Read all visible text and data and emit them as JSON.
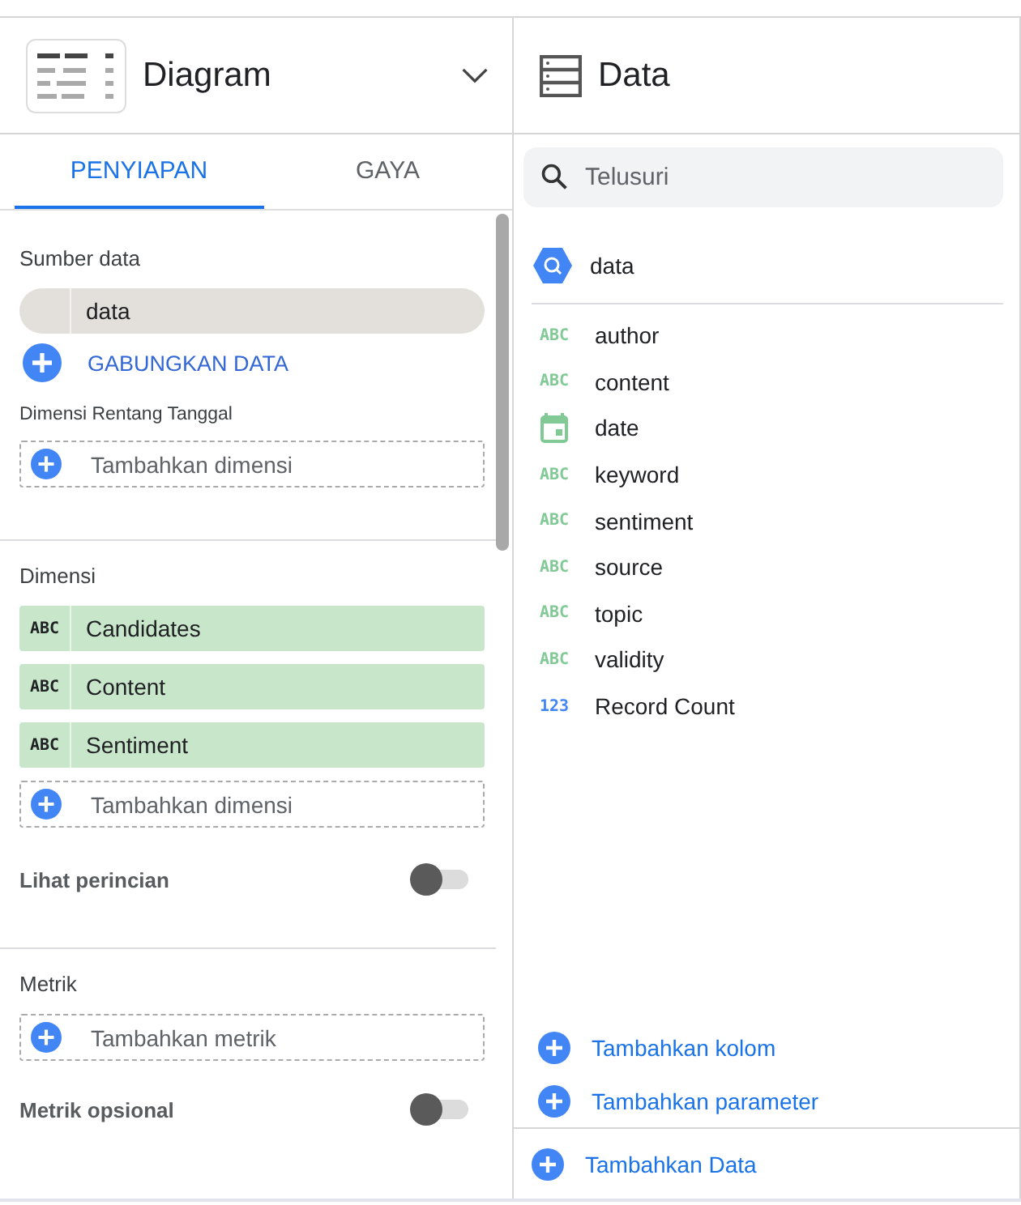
{
  "chart_panel": {
    "title": "Diagram"
  },
  "tabs": [
    {
      "label": "PENYIAPAN",
      "selected": true
    },
    {
      "label": "GAYA",
      "selected": false
    }
  ],
  "data_source": {
    "heading": "Sumber data",
    "name": "data",
    "blend_label": "GABUNGKAN DATA"
  },
  "date_range": {
    "heading": "Dimensi Rentang Tanggal",
    "add_label": "Tambahkan dimensi"
  },
  "dimensions": {
    "heading": "Dimensi",
    "items": [
      {
        "type_label": "ABC",
        "name": "Candidates"
      },
      {
        "type_label": "ABC",
        "name": "Content"
      },
      {
        "type_label": "ABC",
        "name": "Sentiment"
      }
    ],
    "add_label": "Tambahkan dimensi",
    "drilldown": {
      "label": "Lihat perincian",
      "on": false
    }
  },
  "metrics": {
    "heading": "Metrik",
    "add_label": "Tambahkan metrik",
    "optional": {
      "label": "Metrik opsional",
      "on": false
    }
  },
  "data_panel": {
    "title": "Data",
    "search_placeholder": "Telusuri",
    "source_name": "data",
    "fields": [
      {
        "kind": "text",
        "type_label": "ABC",
        "name": "author"
      },
      {
        "kind": "text",
        "type_label": "ABC",
        "name": "content"
      },
      {
        "kind": "date",
        "name": "date"
      },
      {
        "kind": "text",
        "type_label": "ABC",
        "name": "keyword"
      },
      {
        "kind": "text",
        "type_label": "ABC",
        "name": "sentiment"
      },
      {
        "kind": "text",
        "type_label": "ABC",
        "name": "source"
      },
      {
        "kind": "text",
        "type_label": "ABC",
        "name": "topic"
      },
      {
        "kind": "text",
        "type_label": "ABC",
        "name": "validity"
      },
      {
        "kind": "number",
        "type_label": "123",
        "name": "Record Count"
      }
    ],
    "actions": [
      "Tambahkan kolom",
      "Tambahkan parameter"
    ],
    "add_data_label": "Tambahkan Data"
  }
}
